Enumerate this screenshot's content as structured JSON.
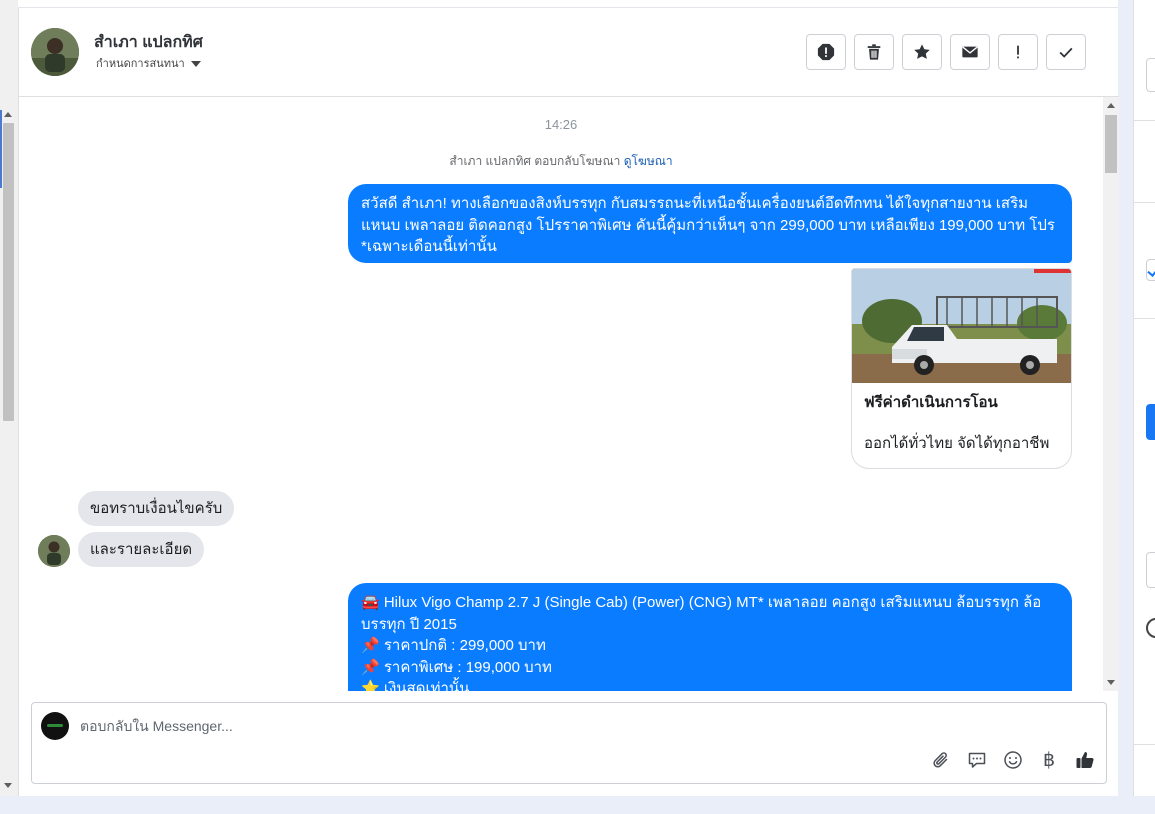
{
  "header": {
    "contact_name": "สำเภา แปลกทิศ",
    "assign_label": "กำหนดการสนทนา"
  },
  "actions": [
    {
      "name": "report-icon"
    },
    {
      "name": "trash-icon"
    },
    {
      "name": "star-icon"
    },
    {
      "name": "envelope-icon"
    },
    {
      "name": "exclamation-icon"
    },
    {
      "name": "check-icon"
    }
  ],
  "messages": {
    "timestamp": "14:26",
    "reply_note_prefix": "สำเภา แปลกทิศ ตอบกลับโฆษณา",
    "reply_note_link": "ดูโฆษณา",
    "outgoing_1": "สวัสดี สำเภา! ทางเลือกของสิงห์บรรทุก กับสมรรถนะที่เหนือชั้นเครื่องยนต์อึดทึกทน ได้ใจทุกสายงาน เสริมแหนบ เพลาลอย ติดคอกสูง โปรราคาพิเศษ คันนี้คุ้มกว่าเห็นๆ  จาก 299,000 บาท เหลือเพียง 199,000 บาท โปร *เฉพาะเดือนนี้เท่านั้น",
    "card": {
      "title": "ฟรีค่าดำเนินการโอน",
      "subtitle": "ออกได้ทั่วไทย จัดได้ทุกอาชีพ"
    },
    "incoming_1": "ขอทราบเงื่อนไขครับ",
    "incoming_2": "และรายละเอียด",
    "outgoing_2": {
      "line1": "🚘 Hilux Vigo Champ 2.7 J (Single Cab) (Power) (CNG) MT* เพลาลอย คอกสูง เสริมแหนบ ล้อบรรทุก ล้อบรรทุก ปี 2015",
      "line2": "📌 ราคาปกติ : 299,000 บาท",
      "line3": "📌 ราคาพิเศษ : 199,000 บาท",
      "line4": "⭐ เงินสดเท่านั้น"
    }
  },
  "composer": {
    "placeholder": "ตอบกลับใน Messenger...",
    "currency_symbol": "฿"
  },
  "colors": {
    "outgoing_bubble": "#0a7cff",
    "incoming_bubble": "#e4e6eb",
    "accent": "#1877f2"
  }
}
